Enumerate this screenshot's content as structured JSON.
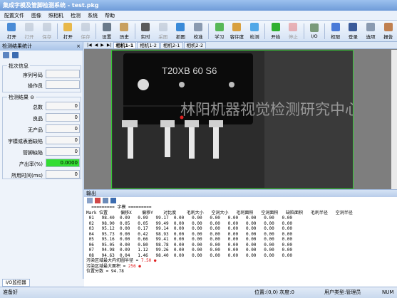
{
  "window": {
    "title": "集成字模及管脚检测系统 - test.pkg"
  },
  "menu": [
    "配置文件",
    "图像",
    "照相机",
    "检测",
    "系统",
    "帮助"
  ],
  "toolbar": [
    {
      "label": "打开",
      "color": "#4a8bd6",
      "enabled": true
    },
    {
      "label": "打开",
      "color": "#9aa8b8",
      "enabled": false
    },
    {
      "label": "保存",
      "color": "#9aa8b8",
      "enabled": false
    },
    {
      "label": "打开",
      "color": "#e8b84a",
      "enabled": true
    },
    {
      "label": "保存",
      "color": "#9aa8b8",
      "enabled": false
    },
    {
      "label": "设置",
      "color": "#6a7a8a",
      "enabled": true
    },
    {
      "label": "历史",
      "color": "#c8a060",
      "enabled": true
    },
    {
      "label": "实时",
      "color": "#5a5a5a",
      "enabled": true
    },
    {
      "label": "采图",
      "color": "#9aa8b8",
      "enabled": false
    },
    {
      "label": "抓图",
      "color": "#3a8ad8",
      "enabled": true
    },
    {
      "label": "校准",
      "color": "#8a9ab0",
      "enabled": true
    },
    {
      "label": "学习",
      "color": "#58b858",
      "enabled": true
    },
    {
      "label": "容许度",
      "color": "#d8a040",
      "enabled": true
    },
    {
      "label": "检测",
      "color": "#50a8e8",
      "enabled": true
    },
    {
      "label": "开始",
      "color": "#30b030",
      "enabled": true
    },
    {
      "label": "停止",
      "color": "#e05050",
      "enabled": false
    },
    {
      "label": "I/O",
      "color": "#7a9a7a",
      "enabled": true
    },
    {
      "label": "权限",
      "color": "#4a7ad8",
      "enabled": true
    },
    {
      "label": "登录",
      "color": "#3a5a9a",
      "enabled": true
    },
    {
      "label": "选项",
      "color": "#8a9ab0",
      "enabled": true
    },
    {
      "label": "报告",
      "color": "#c08050",
      "enabled": true
    }
  ],
  "left": {
    "title": "检测结果统计",
    "close": "×",
    "info_group": "批次信息",
    "info_fields": [
      {
        "label": "序列号码",
        "value": ""
      },
      {
        "label": "操作员",
        "value": ""
      }
    ],
    "result_group": "检测结果",
    "result_fields": [
      {
        "label": "总数",
        "value": "0"
      },
      {
        "label": "良品",
        "value": "0"
      },
      {
        "label": "无产品",
        "value": "0"
      },
      {
        "label": "字模或表面缺陷",
        "value": "0"
      },
      {
        "label": "管脚缺陷",
        "value": "0"
      },
      {
        "label": "产出率(%)",
        "value": "0.0000",
        "highlight": true
      },
      {
        "label": "所用时间(ms)",
        "value": "0"
      }
    ]
  },
  "image": {
    "tabs": [
      "相机1-1",
      "相机1-2",
      "相机2-1",
      "相机2-2"
    ],
    "active_tab": 0,
    "part_marking": "T20XB 60 S6",
    "watermark": "林阳机器视觉检测研究中心"
  },
  "output": {
    "title": "输出",
    "separator": "========= 字模 =========",
    "headers": [
      "Mark",
      "位置",
      "偏移X",
      "偏移Y",
      "对比度",
      "毛刺大小",
      "空洞大小",
      "毛刺面积",
      "空洞面积",
      "缺陷面积",
      "毛刺半径",
      "空洞半径"
    ],
    "rows": [
      [
        "01",
        "98.40",
        "0.09",
        "0.09",
        "99.17",
        "0.00",
        "0.00",
        "0.00",
        "0.00",
        "0.00",
        "0.00",
        "0.00"
      ],
      [
        "02",
        "98.90",
        "0.05",
        "0.05",
        "99.49",
        "0.00",
        "0.00",
        "0.00",
        "0.00",
        "0.00",
        "0.00",
        "0.00"
      ],
      [
        "03",
        "95.12",
        "0.00",
        "0.17",
        "99.14",
        "0.00",
        "0.00",
        "0.00",
        "0.00",
        "0.00",
        "0.00",
        "0.00"
      ],
      [
        "04",
        "95.73",
        "0.00",
        "0.42",
        "98.93",
        "0.00",
        "0.00",
        "0.00",
        "0.00",
        "0.00",
        "0.00",
        "0.00"
      ],
      [
        "05",
        "95.16",
        "0.00",
        "0.66",
        "99.41",
        "0.00",
        "0.00",
        "0.00",
        "0.00",
        "0.00",
        "0.00",
        "0.00"
      ],
      [
        "06",
        "95.05",
        "0.00",
        "0.80",
        "98.78",
        "0.00",
        "0.00",
        "0.00",
        "0.00",
        "0.00",
        "0.00",
        "0.00"
      ],
      [
        "07",
        "94.98",
        "0.09",
        "1.12",
        "99.26",
        "0.00",
        "0.00",
        "0.00",
        "0.00",
        "0.00",
        "0.00",
        "0.00"
      ],
      [
        "08",
        "94.63",
        "0.04",
        "1.46",
        "98.40",
        "0.00",
        "0.00",
        "0.00",
        "0.00",
        "0.00",
        "0.00",
        "0.00"
      ]
    ],
    "notes": [
      {
        "label": "污染区域最大内切圆半径 = ",
        "value": "7.50"
      },
      {
        "label": "污染区域最大面积 = ",
        "value": "256"
      },
      {
        "label": "位置分数 = 94.78",
        "value": ""
      }
    ]
  },
  "bottom_tab": "I/O监控器",
  "status": {
    "left": "准备好",
    "position": "位置:(0,0) 灰度:0",
    "user": "用户类型:管理员",
    "num": "NUM"
  }
}
